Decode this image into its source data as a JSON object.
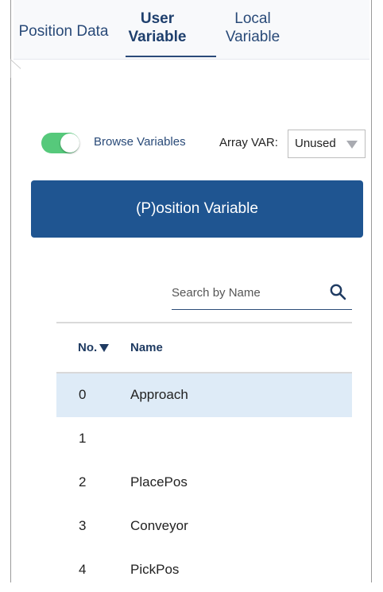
{
  "tabs": [
    {
      "label": "Position Data",
      "selected": false
    },
    {
      "label": "User\nVariable",
      "selected": true
    },
    {
      "label": "Local\nVariable",
      "selected": false
    }
  ],
  "controls": {
    "browse_label": "Browse Variables",
    "browse_enabled": true,
    "array_label": "Array VAR:",
    "array_value": "Unused"
  },
  "main_button": {
    "label": "(P)osition Variable"
  },
  "search": {
    "placeholder": "Search by Name"
  },
  "table": {
    "columns": [
      "No.",
      "Name"
    ],
    "rows": [
      {
        "no": "0",
        "name": "Approach",
        "selected": true
      },
      {
        "no": "1",
        "name": "",
        "selected": false
      },
      {
        "no": "2",
        "name": "PlacePos",
        "selected": false
      },
      {
        "no": "3",
        "name": "Conveyor",
        "selected": false
      },
      {
        "no": "4",
        "name": "PickPos",
        "selected": false
      }
    ]
  },
  "colors": {
    "accent": "#1f5591",
    "toggle_on": "#56c97b",
    "selection": "#deebf7"
  },
  "icons": {
    "search": "search-icon",
    "dropdown": "chevron-down-icon",
    "sort": "sort-down-icon"
  }
}
